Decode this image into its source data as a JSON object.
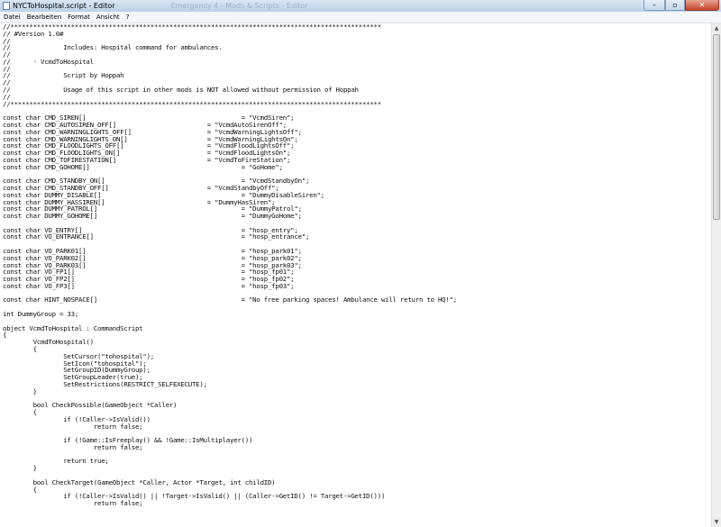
{
  "window": {
    "title": "NYCToHospital.script - Editor",
    "background_title_fragment": "Emergency 4 - Mods & Scripts - Editor",
    "controls": {
      "minimize": "–",
      "maximize": "▫",
      "close": "✕"
    }
  },
  "menu": [
    "Datei",
    "Bearbeiten",
    "Format",
    "Ansicht",
    "?"
  ],
  "editor": {
    "lines": [
      "//**************************************************************************************************",
      "// #Version 1.0#",
      "//",
      "//              Includes: Hospital command for ambulances.",
      "//",
      "//      - VcmdToHospital",
      "//",
      "//              Script by Hoppah",
      "//",
      "//              Usage of this script in other mods is NOT allowed without permission of Hoppah",
      "//",
      "//**************************************************************************************************",
      "",
      "const char CMD_SIREN[]                                         = \"VcmdSiren\";",
      "const char CMD_AUTOSIREN_OFF[]                        = \"VcmdAutoSirenOff\";",
      "const char CMD_WARNINGLIGHTS_OFF[]                    = \"VcmdWarningLightsOff\";",
      "const char CMD_WARNINGLIGHTS_ON[]                     = \"VcmdWarningLightsOn\";",
      "const char CMD_FLOODLIGHTS_OFF[]                      = \"VcmdFloodLightsOff\";",
      "const char CMD_FLOODLIGHTS_ON[]                       = \"VcmdFloodLightsOn\";",
      "const char CMD_TOFIRESTATION[]                        = \"VcmdToFireStation\";",
      "const char CMD_GOHOME[]                                        = \"GoHome\";",
      "",
      "const char CMD_STANDBY_ON[]                                    = \"VcmdStandbyOn\";",
      "const char CMD_STANDBY_OFF[]                          = \"VcmdStandbyOff\";",
      "const char DUMMY_DISABLE[]                                     = \"DummyDisableSiren\";",
      "const char DUMMY_HASSIREN[]                           = \"DummyHasSiren\";",
      "const char DUMMY_PATROL[]                                      = \"DummyPatrol\";",
      "const char DUMMY_GOHOME[]                                      = \"DummyGoHome\";",
      "",
      "const char VO_ENTRY[]                                          = \"hosp_entry\";",
      "const char VO_ENTRANCE[]                                       = \"hosp_entrance\";",
      "",
      "const char VO_PARK01[]                                         = \"hosp_park01\";",
      "const char VO_PARK02[]                                         = \"hosp_park02\";",
      "const char VO_PARK03[]                                         = \"hosp_park03\";",
      "const char VO_FP1[]                                            = \"hosp_fp01\";",
      "const char VO_FP2[]                                            = \"hosp_fp02\";",
      "const char VO_FP3[]                                            = \"hosp_fp03\";",
      "",
      "const char HINT_NOSPACE[]                                      = \"No free parking spaces! Ambulance will return to HQ!\";",
      "",
      "int DummyGroup = 33;",
      "",
      "object VcmdToHospital : CommandScript",
      "{",
      "        VcmdToHospital()",
      "        {",
      "                SetCursor(\"tohospital\");",
      "                SetIcon(\"tohospital\");",
      "                SetGroupID(DummyGroup);",
      "                SetGroupLeader(true);",
      "                SetRestrictions(RESTRICT_SELFEXECUTE);",
      "        }",
      "",
      "        bool CheckPossible(GameObject *Caller)",
      "        {",
      "                if (!Caller->IsValid())",
      "                        return false;",
      "",
      "                if (!Game::IsFreeplay() && !Game::IsMultiplayer())",
      "                        return false;",
      "",
      "                return true;",
      "        }",
      "",
      "        bool CheckTarget(GameObject *Caller, Actor *Target, int childID)",
      "        {",
      "                if (!Caller->IsValid() || !Target->IsValid() || (Caller->GetID() != Target->GetID()))",
      "                        return false;"
    ]
  }
}
